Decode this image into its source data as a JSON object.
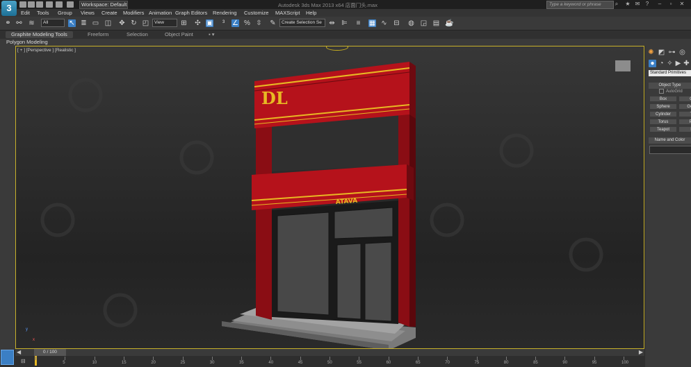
{
  "titlebar": {
    "logo_text": "3",
    "workspace": "Workspace: Default",
    "title": "Autodesk 3ds Max  2013 x64    店面门头.max",
    "search_placeholder": "Type a keyword or phrase"
  },
  "menu": [
    "Edit",
    "Tools",
    "Group",
    "Views",
    "Create",
    "Modifiers",
    "Animation",
    "Graph Editors",
    "Rendering",
    "Customize",
    "MAXScript",
    "Help"
  ],
  "toolbar": {
    "selection_filter": "All",
    "reference_coord": "View",
    "named_selection": "Create Selection Se"
  },
  "ribbon": {
    "tabs": [
      "Graphite Modeling Tools",
      "Freeform",
      "Selection",
      "Object Paint"
    ],
    "panel_label": "Polygon Modeling"
  },
  "viewport": {
    "label": "[ + ] [Perspective ] [Realistic ]",
    "axis_y": "y",
    "axis_x": "x",
    "sign_text": "DL",
    "sign_small_text": "ATAVA"
  },
  "command_panel": {
    "category": "Standard Primitives",
    "object_type_header": "Object Type",
    "autogrid_label": "AutoGrid",
    "primitives": [
      "Box",
      "Co",
      "Sphere",
      "GeoS",
      "Cylinder",
      "Tu",
      "Torus",
      "Pyr",
      "Teapot",
      "Pl"
    ],
    "name_color_header": "Name and Color"
  },
  "timeline": {
    "frame_indicator": "0 / 100",
    "ticks": [
      "0",
      "5",
      "10",
      "15",
      "20",
      "25",
      "30",
      "35",
      "40",
      "45",
      "50",
      "55",
      "60",
      "65",
      "70",
      "75",
      "80",
      "85",
      "90",
      "95",
      "100"
    ]
  },
  "colors": {
    "accent_blue": "#3b7fc4",
    "viewport_border": "#c8b12a",
    "facade_red": "#b5121b",
    "sign_gold": "#e8b923"
  }
}
